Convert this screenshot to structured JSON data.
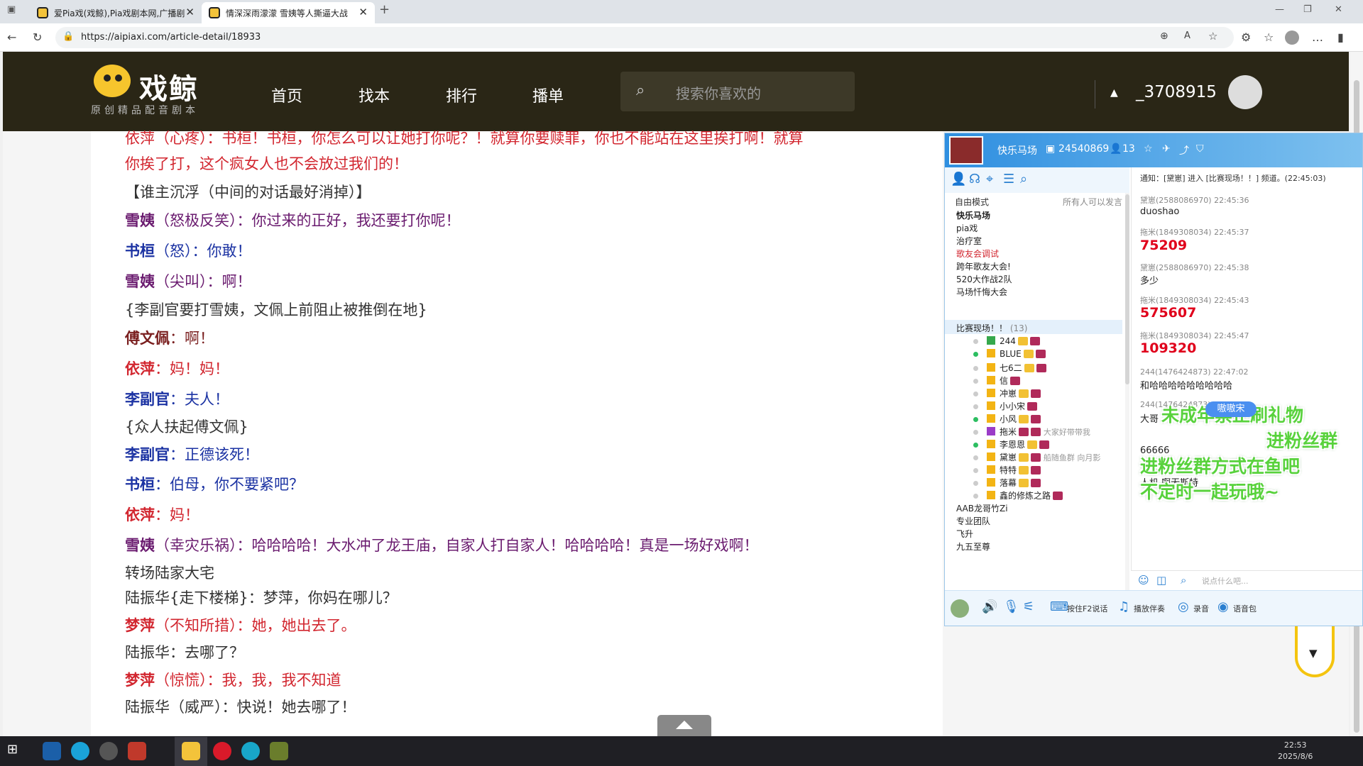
{
  "browser": {
    "tab1": "爱Pia戏(戏鲸),Pia戏剧本网,广播剧",
    "tab2": "情深深雨濛濛 雪姨等人撕逼大战",
    "url": "https://aipiaxi.com/article-detail/18933"
  },
  "site": {
    "logo": "戏鲸",
    "slogan": "原创精品配音剧本",
    "nav": [
      "首页",
      "找本",
      "排行",
      "播单"
    ],
    "search_placeholder": "搜索你喜欢的",
    "username": "_3708915"
  },
  "script": {
    "l0": "依萍（心疼）：书桓！书桓，你怎么可以让她打你呢？！就算你要赎罪，你也不能站在这里挨打啊！就算",
    "l1": "你挨了打，这个疯女人也不会放过我们的！",
    "l2": "【谁主沉浮（中间的对话最好消掉）】",
    "l3n": "雪姨",
    "l3": "（怒极反笑）：你过来的正好，我还要打你呢！",
    "l4n": "书桓",
    "l4": "（怒）：你敢！",
    "l5n": "雪姨",
    "l5": "（尖叫）：啊！",
    "l6": "{李副官要打雪姨，文佩上前阻止被推倒在地}",
    "l7n": "傅文佩",
    "l7": "：啊！",
    "l8n": "依萍",
    "l8": "：妈！妈！",
    "l9n": "李副官",
    "l9": "：夫人！",
    "l10": "{众人扶起傅文佩}",
    "l11n": "李副官",
    "l11": "：正德该死！",
    "l12n": "书桓",
    "l12": "：伯母，你不要紧吧？",
    "l13n": "依萍",
    "l13": "：妈！",
    "l14n": "雪姨",
    "l14": "（幸灾乐祸）：哈哈哈哈！大水冲了龙王庙，自家人打自家人！哈哈哈哈！真是一场好戏啊！",
    "l15": "转场陆家大宅",
    "l16": "陆振华{走下楼梯}：梦萍，你妈在哪儿？",
    "l17n": "梦萍",
    "l17": "（不知所措）：她，她出去了。",
    "l18": "陆振华：去哪了？",
    "l19n": "梦萍",
    "l19": "（惊慌）：我，我，我不知道",
    "l20": "陆振华（威严）：快说！她去哪了！"
  },
  "yy": {
    "channel_name": "快乐马场",
    "channel_id": "24540869",
    "online": "13",
    "mode": "自由模式",
    "mode_note": "所有人可以发言",
    "channels": [
      "快乐马场",
      "pia戏",
      "治疗室",
      "歌友会调试",
      "跨年歌友大会!",
      "520大作战2队",
      "马场忏悔大会"
    ],
    "active_channel": "比赛现场！！",
    "active_count": "(13)",
    "members": [
      "244",
      "BLUE",
      "七6二",
      "信",
      "冲崽",
      "小小宋",
      "小风",
      "拖米",
      "李恩恩",
      "黛崽",
      "特特",
      "落幕",
      "鑫的修炼之路"
    ],
    "member_notes": {
      "m7": "大家好带带我",
      "m9": "船随鱼群 向月影"
    },
    "channels2": [
      "AAB龙哥竹Zi",
      "专业团队",
      "飞升",
      "九五至尊"
    ],
    "notice": "通知：[黛崽] 进入 [比赛现场！！] 频道。(22:45:03)",
    "messages": [
      {
        "h": "黛崽(2588086970)  22:45:36",
        "b": "duoshao"
      },
      {
        "h": "拖米(1849308034)  22:45:37",
        "b": "75209"
      },
      {
        "h": "黛崽(2588086970)  22:45:38",
        "b": "多少"
      },
      {
        "h": "拖米(1849308034)  22:45:43",
        "b": "575607"
      },
      {
        "h": "拖米(1849308034)  22:45:47",
        "b": "109320"
      },
      {
        "h": "244(1476424873)  22:47:02",
        "b": "和哈哈哈哈哈哈哈哈哈"
      },
      {
        "h": "244(1476424873)  22:47:",
        "b": "大哥"
      },
      {
        "b": "66666"
      },
      {
        "b": "人机 啊无斯特"
      }
    ],
    "overlay": [
      "未成年禁止刷礼物",
      "进粉丝群",
      "进粉丝群方式在鱼吧",
      "不定时一起玩哦~"
    ],
    "tip": "嗷嗷宋",
    "input_placeholder": "说点什么吧...",
    "bottom": [
      "按住F2说话",
      "播放伴奏",
      "录音",
      "语音包"
    ]
  },
  "taskbar": {
    "time": "22:53",
    "date": "2025/8/6"
  }
}
